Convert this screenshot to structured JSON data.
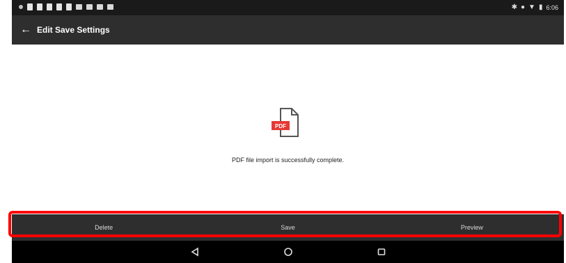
{
  "status_bar": {
    "time": "6:06"
  },
  "app_bar": {
    "title": "Edit Save Settings",
    "back_icon": "arrow-left-icon"
  },
  "content": {
    "file_icon": "pdf-file-icon",
    "file_badge": "PDF",
    "message": "PDF file import is successfully complete."
  },
  "actions": {
    "delete_label": "Delete",
    "save_label": "Save",
    "preview_label": "Preview"
  },
  "nav": {
    "back": "nav-back-icon",
    "home": "nav-home-icon",
    "recents": "nav-recents-icon"
  },
  "colors": {
    "bar": "#2e2e2e",
    "status": "#1a1a1a",
    "highlight": "#ff0000",
    "pdf_red": "#e53935"
  }
}
